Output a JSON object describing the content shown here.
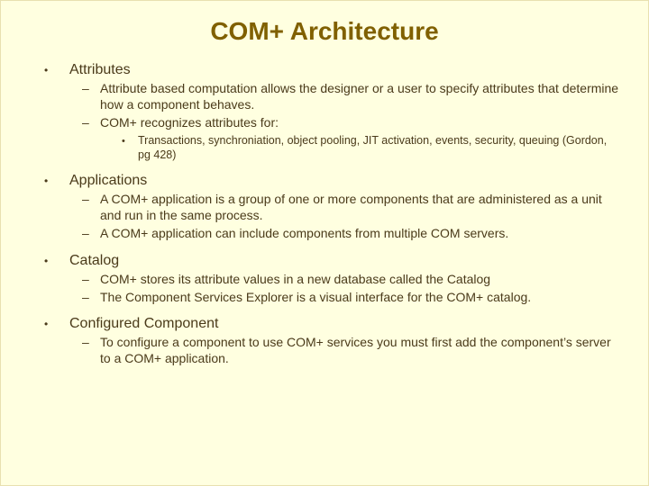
{
  "title": "COM+ Architecture",
  "sections": [
    {
      "heading": "Attributes",
      "points": [
        {
          "text": "Attribute based computation allows the designer or a user to specify attributes that determine how a component behaves."
        },
        {
          "text": "COM+ recognizes attributes for:",
          "sub": [
            "Transactions, synchroniation, object pooling, JIT activation, events, security, queuing (Gordon, pg 428)"
          ]
        }
      ]
    },
    {
      "heading": "Applications",
      "points": [
        {
          "text": "A COM+ application is a group of one or more components that are administered as a unit and run in the same process."
        },
        {
          "text": "A COM+ application can include components from multiple COM servers."
        }
      ]
    },
    {
      "heading": "Catalog",
      "points": [
        {
          "text": "COM+ stores its attribute values in a new database called the Catalog"
        },
        {
          "text": "The Component Services Explorer is a visual interface for the COM+ catalog."
        }
      ]
    },
    {
      "heading": "Configured Component",
      "points": [
        {
          "text": "To configure a component to use COM+ services you must first add the component’s server to a COM+ application."
        }
      ]
    }
  ]
}
